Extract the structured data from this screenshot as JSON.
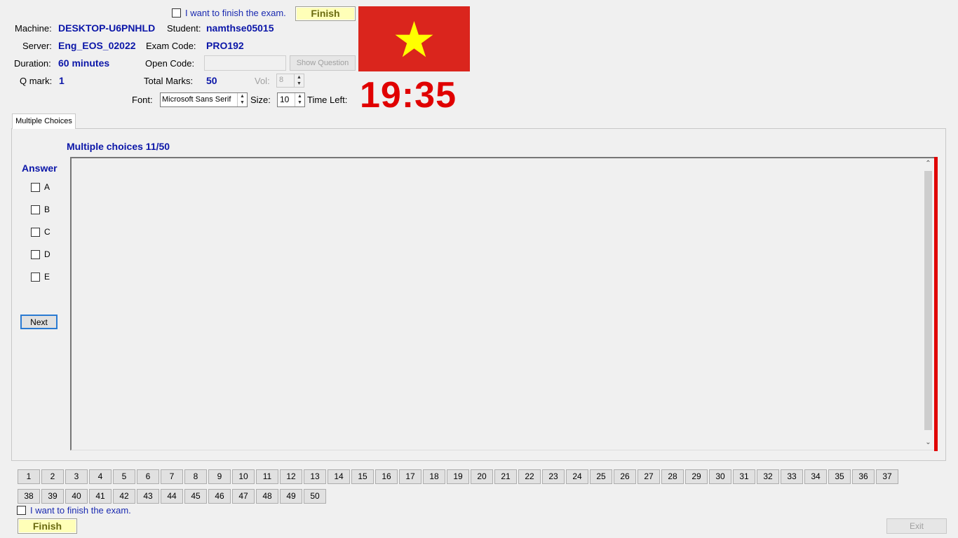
{
  "header": {
    "finish_check_label": "I want to finish the exam.",
    "finish_button": "Finish",
    "machine_label": "Machine:",
    "machine_value": "DESKTOP-U6PNHLD",
    "student_label": "Student:",
    "student_value": "namthse05015",
    "server_label": "Server:",
    "server_value": "Eng_EOS_02022",
    "exam_code_label": "Exam Code:",
    "exam_code_value": "PRO192",
    "duration_label": "Duration:",
    "duration_value": "60 minutes",
    "open_code_label": "Open Code:",
    "open_code_value": "",
    "show_question_button": "Show Question",
    "qmark_label": "Q mark:",
    "qmark_value": "1",
    "total_marks_label": "Total Marks:",
    "total_marks_value": "50",
    "vol_label": "Vol:",
    "vol_value": "8",
    "font_label": "Font:",
    "font_value": "Microsoft Sans Serif",
    "size_label": "Size:",
    "size_value": "10",
    "time_left_label": "Time Left:",
    "time_left_value": "19:35",
    "flag_colors": {
      "field": "#da251d",
      "star": "#ffff00"
    }
  },
  "tabs": [
    {
      "label": "Multiple Choices"
    }
  ],
  "question": {
    "title": "Multiple choices 11/50",
    "answer_heading": "Answer",
    "options": [
      "A",
      "B",
      "C",
      "D",
      "E"
    ],
    "next_button": "Next"
  },
  "navigation": {
    "row1": [
      "1",
      "2",
      "3",
      "4",
      "5",
      "6",
      "7",
      "8",
      "9",
      "10",
      "11",
      "12",
      "13",
      "14",
      "15",
      "16",
      "17",
      "18",
      "19",
      "20",
      "21",
      "22",
      "23",
      "24",
      "25",
      "26",
      "27",
      "28",
      "29",
      "30",
      "31",
      "32",
      "33",
      "34",
      "35",
      "36",
      "37"
    ],
    "row2": [
      "38",
      "39",
      "40",
      "41",
      "42",
      "43",
      "44",
      "45",
      "46",
      "47",
      "48",
      "49",
      "50"
    ]
  },
  "footer": {
    "finish_check_label": "I want to finish the exam.",
    "finish_button": "Finish",
    "exit_button": "Exit"
  },
  "colors": {
    "accent_blue": "#0b16a8",
    "timer_red": "#e00000",
    "finish_yellow": "#ffffb8"
  }
}
